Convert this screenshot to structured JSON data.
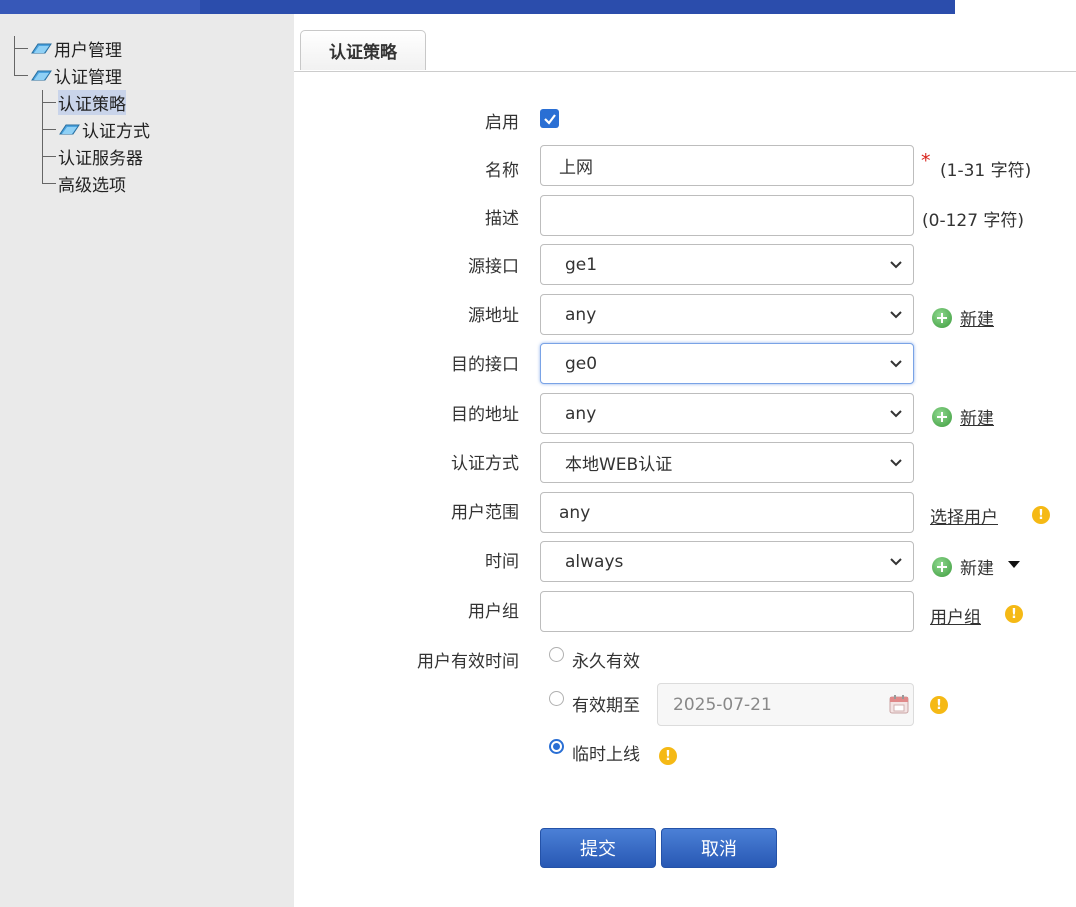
{
  "sidebar": {
    "items": [
      {
        "label": "用户管理"
      },
      {
        "label": "认证管理"
      },
      {
        "label": "认证策略"
      },
      {
        "label": "认证方式"
      },
      {
        "label": "认证服务器"
      },
      {
        "label": "高级选项"
      }
    ]
  },
  "tab": {
    "label": "认证策略"
  },
  "form": {
    "enable_label": "启用",
    "enable_checked": true,
    "name_label": "名称",
    "name_value": "上网",
    "name_hint": "(1-31 字符)",
    "desc_label": "描述",
    "desc_value": "",
    "desc_hint": "(0-127 字符)",
    "src_if_label": "源接口",
    "src_if_value": "ge1",
    "src_addr_label": "源地址",
    "src_addr_value": "any",
    "dst_if_label": "目的接口",
    "dst_if_value": "ge0",
    "dst_addr_label": "目的地址",
    "dst_addr_value": "any",
    "auth_method_label": "认证方式",
    "auth_method_value": "本地WEB认证",
    "user_scope_label": "用户范围",
    "user_scope_value": "any",
    "select_user_link": "选择用户",
    "time_label": "时间",
    "time_value": "always",
    "user_group_label": "用户组",
    "user_group_value": "",
    "user_group_link": "用户组",
    "new_label": "新建",
    "validity_label": "用户有效时间",
    "opt_permanent": "永久有效",
    "opt_until": "有效期至",
    "until_date": "2025-07-21",
    "opt_temp": "临时上线",
    "validity_selected": "临时上线"
  },
  "buttons": {
    "submit": "提交",
    "cancel": "取消"
  },
  "colors": {
    "accent": "#2a6fd4",
    "topbar": "#2b4dac",
    "sidebar_bg": "#eaeaea",
    "required": "#d8241c",
    "warning": "#f5b915",
    "add": "#3c9b3c"
  }
}
